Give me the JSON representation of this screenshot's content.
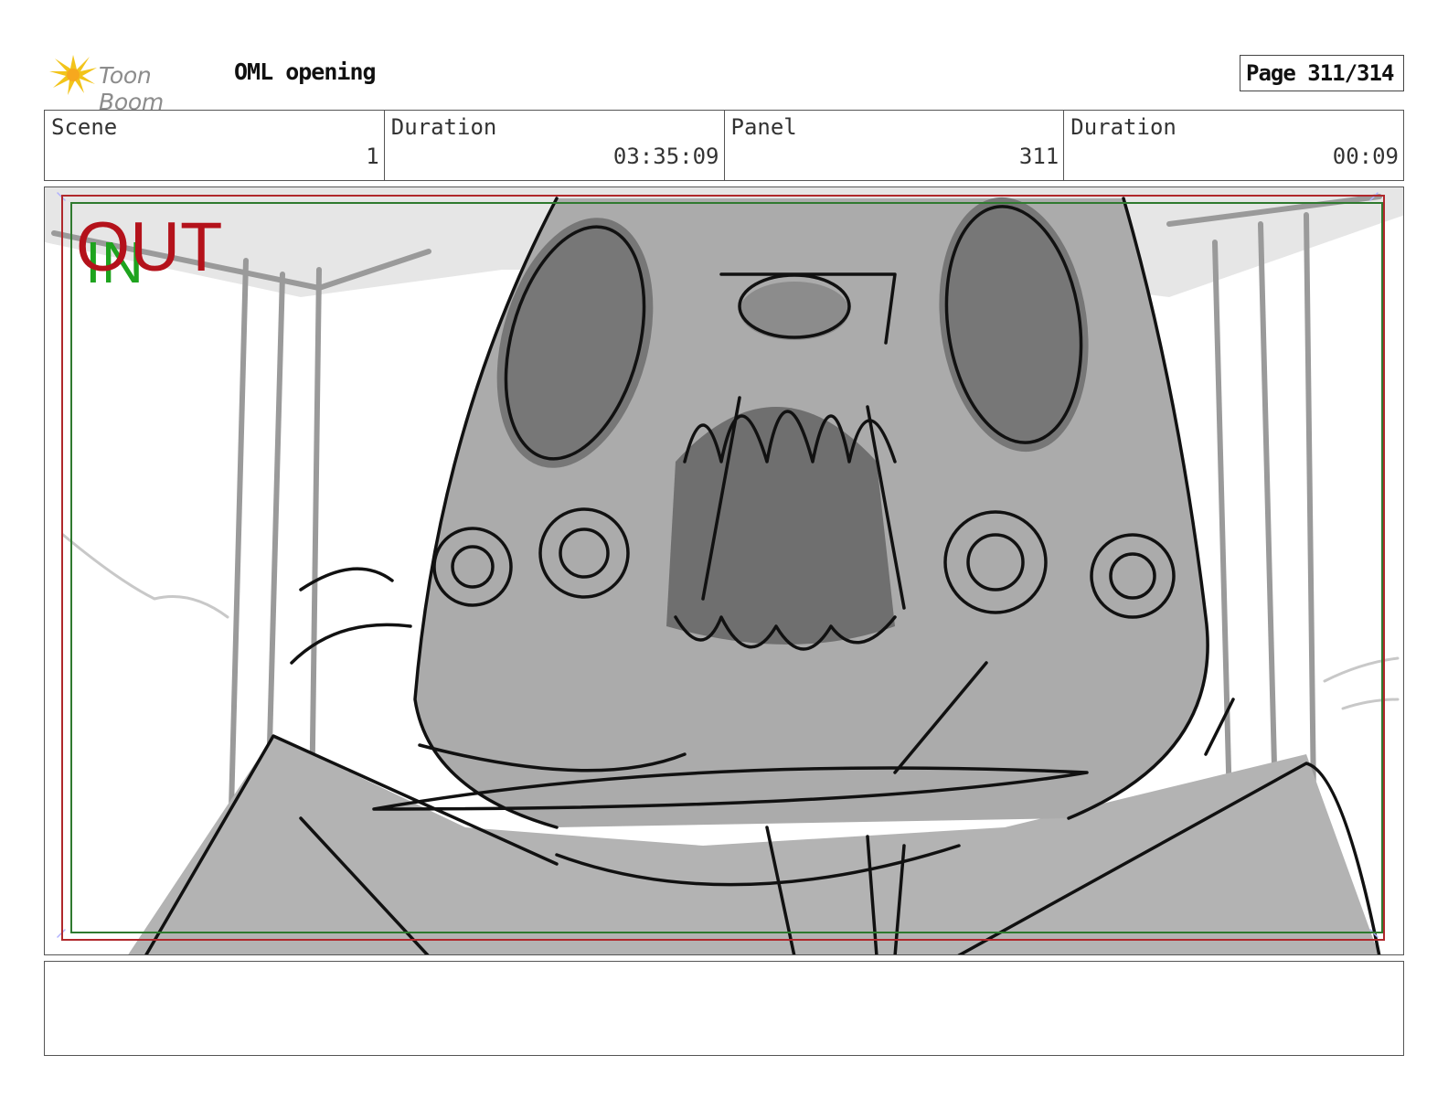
{
  "header": {
    "logo_text": "Toon Boom",
    "logo_icon": "starburst-icon",
    "project_title": "OML opening",
    "page_label": "Page 311/314"
  },
  "info": {
    "scene_label": "Scene",
    "scene_value": "1",
    "duration_label": "Duration",
    "duration_value": "03:35:09",
    "panel_label": "Panel",
    "panel_value": "311",
    "panel_duration_label": "Duration",
    "panel_duration_value": "00:09"
  },
  "panel": {
    "out_marker": "OUT",
    "in_marker": "IN",
    "colors": {
      "out": "#b4121b",
      "in": "#1ea31e",
      "safe_red": "#b0282c",
      "safe_green": "#2f7a2f"
    }
  },
  "notes": {
    "text": ""
  }
}
